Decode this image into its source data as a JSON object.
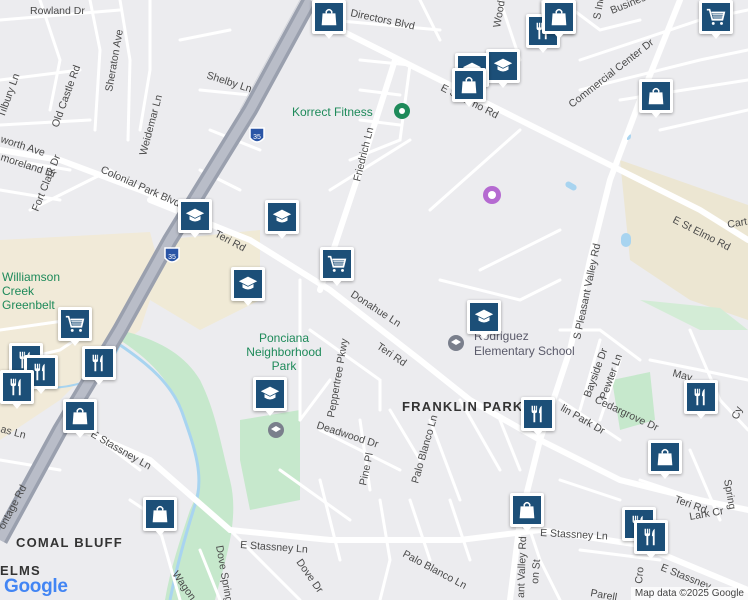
{
  "roads": {
    "rowland_dr": "Rowland Dr",
    "directors_blvd": "Directors Blvd",
    "woodward_st": "Wood",
    "s_industrial": "S Ind",
    "business_center_dr": "Business Center Dr",
    "commercial_center_dr": "Commercial Center Dr",
    "tilbury_ln": "Tilbury Ln",
    "old_castle_rd": "Old Castle Rd",
    "sheraton_ave": "Sheraton Ave",
    "shelby_ln": "Shelby Ln",
    "worth_ave": "worth Ave",
    "weidemar_ln": "Weidemar Ln",
    "moreland_dr": "moreland Dr",
    "fort_clark_dr": "Fort Clark Dr",
    "colonial_park_blvd": "Colonial Park Blvd",
    "friedrich_ln": "Friedrich Ln",
    "e_st_elmo_rd_top": "E St Elmo Rd",
    "e_st_elmo_rd_right": "E St Elmo Rd",
    "carter": "Cart",
    "teri_rd_left": "Teri Rd",
    "teri_rd_mid": "Teri Rd",
    "teri_rd_right": "Teri Rd",
    "donahue_ln": "Donahue Ln",
    "s_pleasant_valley_rd": "S Pleasant Valley Rd",
    "bayside_dr": "Bayside Dr",
    "pewter_ln": "Pewter Ln",
    "cedargrove_dr": "Cedargrove Dr",
    "franklin_park_dr": "lin Park Dr",
    "peppertree_pkwy": "Peppertree Pkwy",
    "deadwood_dr": "Deadwood Dr",
    "pine_pl": "Pine Pl",
    "palo_blanco_ln": "Palo Blanco Ln",
    "palo_blanco_ln_lower": "Palo Blanco Ln",
    "e_stassney_ln_left": "E Stassney Ln",
    "e_stassney_ln_mid": "E Stassney Ln",
    "e_stassney_ln_right": "E Stassney Ln",
    "e_stassney_ln_far": "E Stassney",
    "lark_creek": "Lark Cr",
    "dove_dr": "Dove Dr",
    "wagon": "Wagon",
    "dove_springs": "Dove Spring",
    "frontage_rd": "ontage Rd",
    "as_ln": "as Ln",
    "valley_rd_lower": "ant Valley Rd",
    "croft": "Cro",
    "parell": "Parell",
    "on_st": "on St",
    "spring": "Spring",
    "mavl": "Mav",
    "cy": "Cy",
    "i35_shield": "35"
  },
  "areas": {
    "franklin_park": "FRANKLIN PARK",
    "comal_bluff": "COMAL BLUFF",
    "elms": "ELMS"
  },
  "pois": {
    "korrect_fitness": "Korrect Fitness",
    "williamson_creek_line1": "Williamson",
    "williamson_creek_line2": "Creek",
    "williamson_creek_line3": "Greenbelt",
    "ponciana_line1": "Ponciana",
    "ponciana_line2": "Neighborhood",
    "ponciana_line3": "Park",
    "rodriguez_line1": "Rodriguez",
    "rodriguez_line2": "Elementary School"
  },
  "markers": [
    {
      "type": "school"
    },
    {
      "type": "school"
    },
    {
      "type": "school"
    },
    {
      "type": "school"
    },
    {
      "type": "school"
    },
    {
      "type": "school"
    },
    {
      "type": "school"
    },
    {
      "type": "grocery"
    },
    {
      "type": "grocery"
    },
    {
      "type": "grocery"
    },
    {
      "type": "grocery"
    },
    {
      "type": "restaurant"
    },
    {
      "type": "restaurant"
    },
    {
      "type": "restaurant"
    },
    {
      "type": "restaurant"
    },
    {
      "type": "restaurant"
    },
    {
      "type": "restaurant"
    },
    {
      "type": "restaurant"
    },
    {
      "type": "restaurant"
    },
    {
      "type": "restaurant"
    },
    {
      "type": "shopping"
    },
    {
      "type": "shopping"
    },
    {
      "type": "shopping"
    },
    {
      "type": "shopping"
    },
    {
      "type": "shopping"
    },
    {
      "type": "shopping"
    },
    {
      "type": "shopping"
    },
    {
      "type": "icon-top"
    }
  ],
  "logo": "Google",
  "attribution": "Map data ©2025 Google",
  "colors": {
    "marker_fill": "#1c4f78",
    "park_green": "#c6e8cc",
    "water": "#a8d4f0",
    "highway": "#9aa0ae",
    "background": "#ececef"
  }
}
